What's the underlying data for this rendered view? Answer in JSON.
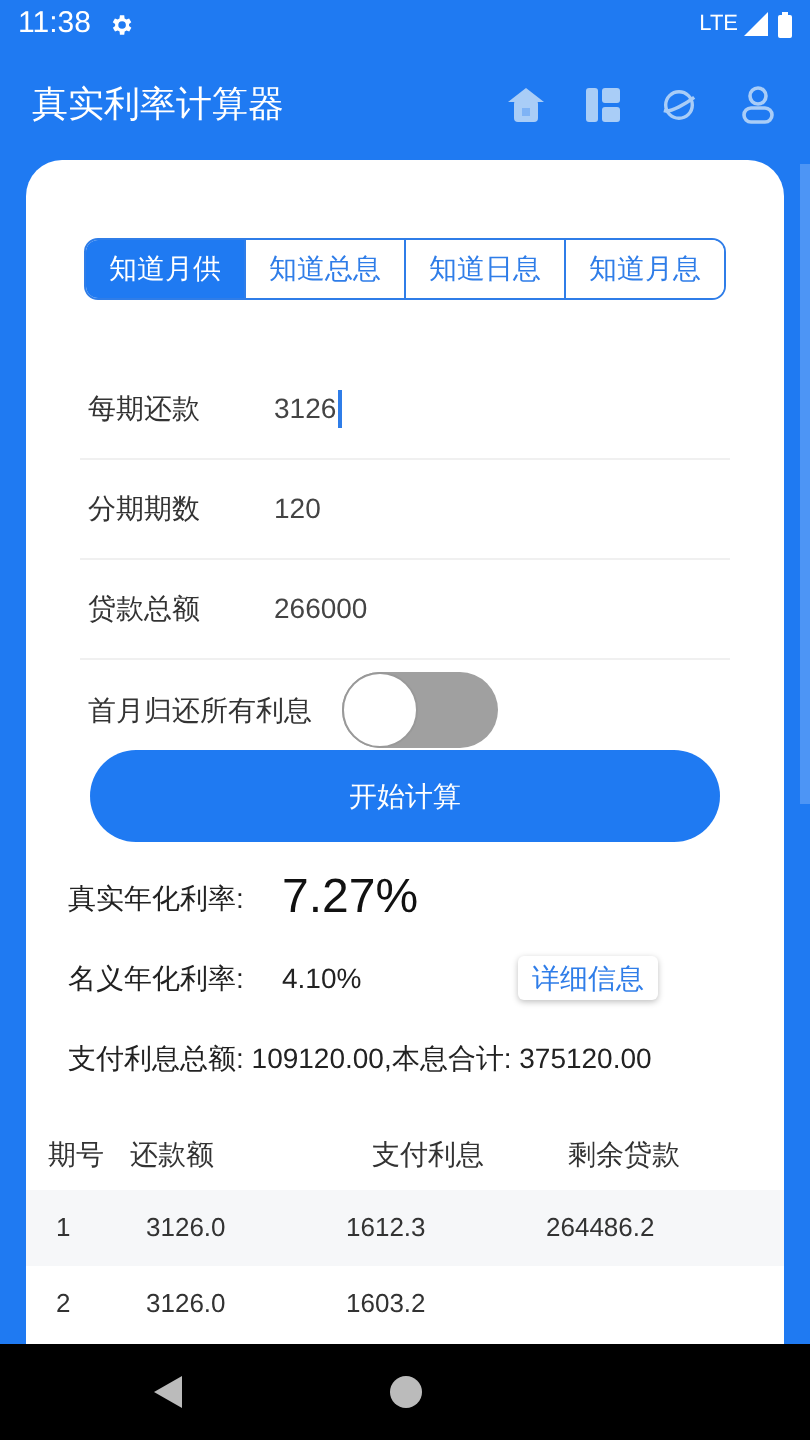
{
  "status_bar": {
    "time": "11:38",
    "network": "LTE"
  },
  "app_bar": {
    "title": "真实利率计算器"
  },
  "tabs": [
    {
      "label": "知道月供",
      "selected": true
    },
    {
      "label": "知道总息",
      "selected": false
    },
    {
      "label": "知道日息",
      "selected": false
    },
    {
      "label": "知道月息",
      "selected": false
    }
  ],
  "fields": [
    {
      "label": "每期还款",
      "value": "3126",
      "focused": true
    },
    {
      "label": "分期期数",
      "value": "120",
      "focused": false
    },
    {
      "label": "贷款总额",
      "value": "266000",
      "focused": false
    }
  ],
  "toggle": {
    "label": "首月归还所有利息",
    "on": false
  },
  "calculate_button": "开始计算",
  "results": {
    "real_rate_label": "真实年化利率:",
    "real_rate": "7.27%",
    "nominal_rate_label": "名义年化利率:",
    "nominal_rate": "4.10%",
    "details_button": "详细信息",
    "totals": "支付利息总额: 109120.00,本息合计: 375120.00"
  },
  "table": {
    "columns": [
      "期号",
      "还款额",
      "支付利息",
      "剩余贷款"
    ],
    "rows": [
      [
        "1",
        "3126.0",
        "1612.3",
        "264486.2"
      ],
      [
        "2",
        "3126.0",
        "1603.2"
      ]
    ]
  }
}
